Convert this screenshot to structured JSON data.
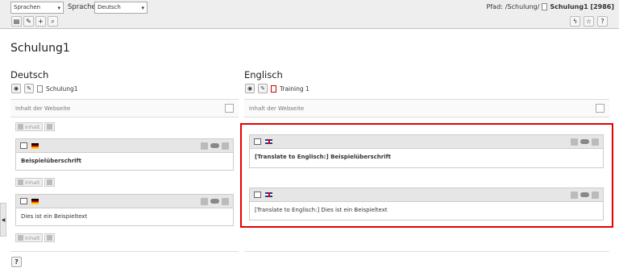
{
  "docheader": {
    "view_select": "Sprachen",
    "language_label": "Sprache:",
    "language_select": "Deutsch",
    "path_label": "Pfad:",
    "path": "/Schulung/",
    "page_title": "Schulung1 [2986]"
  },
  "page": {
    "title": "Schulung1"
  },
  "columns": {
    "de": {
      "title": "Deutsch",
      "page_name": "Schulung1",
      "content_label": "Inhalt der Webseite",
      "new_content_label": "Inhalt",
      "elements": [
        {
          "text": "Beispielüberschrift",
          "bold": true
        },
        {
          "text": "Dies ist ein Beispieltext",
          "bold": false
        }
      ]
    },
    "en": {
      "title": "Englisch",
      "page_name": "Training 1",
      "content_label": "Inhalt der Webseite",
      "elements": [
        {
          "text": "[Translate to Englisch:] Beispielüberschrift",
          "bold": true
        },
        {
          "text": "[Translate to Englisch:] Dies ist ein Beispieltext",
          "bold": false
        }
      ]
    }
  },
  "help_label": "?",
  "accent_color": "#e60000"
}
